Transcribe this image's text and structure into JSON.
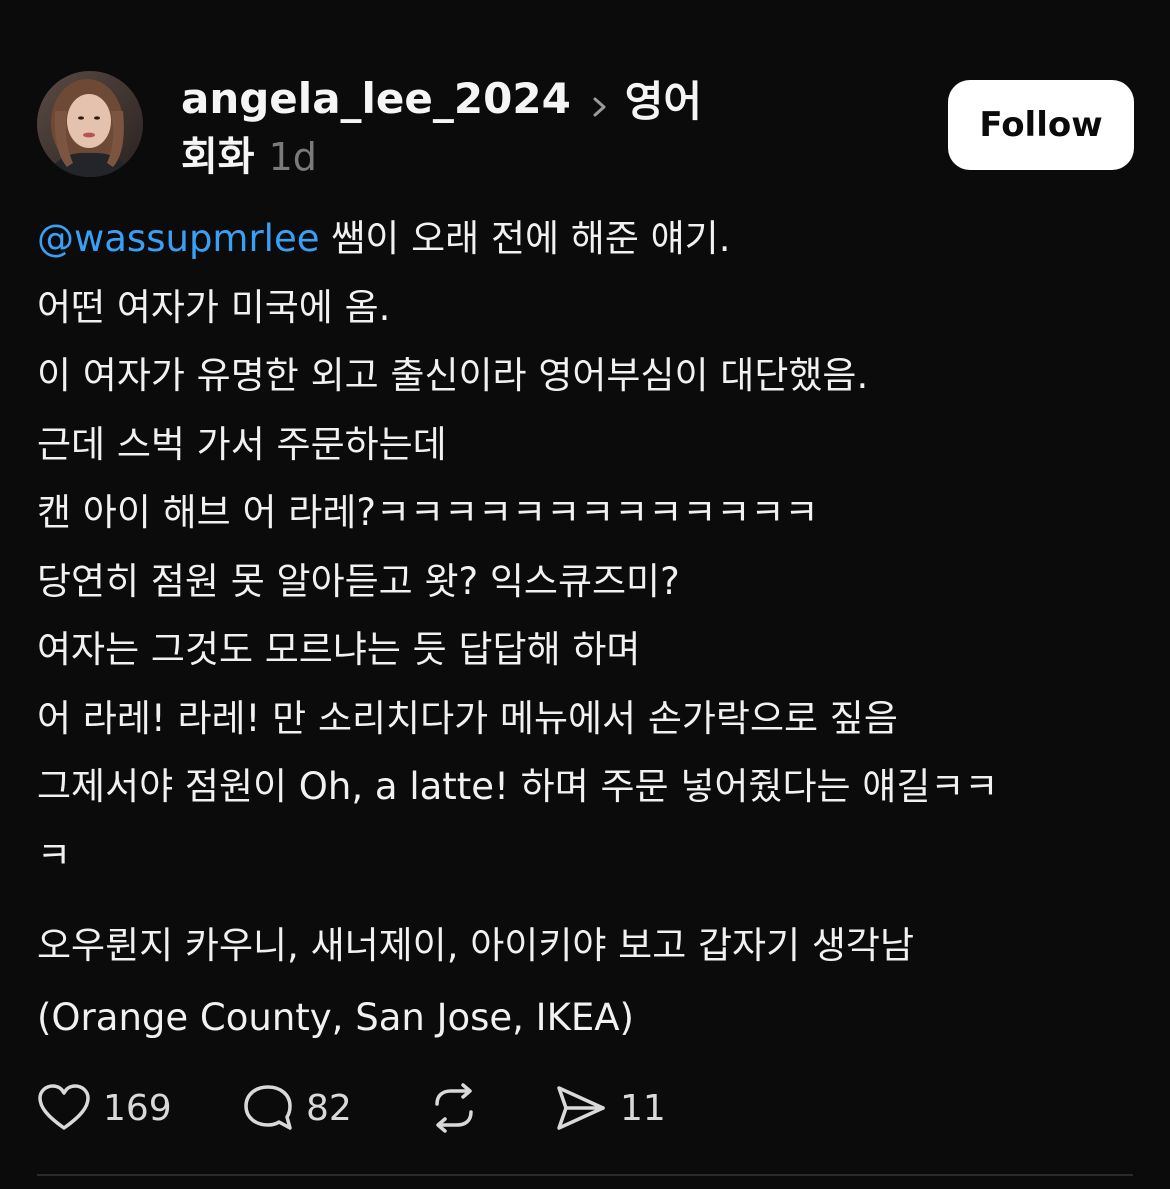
{
  "post": {
    "author": "angela_lee_2024",
    "topic_line1": "영어",
    "topic_line2": "회화",
    "time": "1d",
    "follow_label": "Follow",
    "mention": "@wassupmrlee",
    "line1_rest": " 쌤이 오래 전에 해준 얘기.",
    "lines": [
      "어떤 여자가 미국에 옴.",
      "이 여자가 유명한 외고 출신이라 영어부심이 대단했음.",
      "근데 스벅 가서 주문하는데",
      "캔 아이 해브 어 라레?ㅋㅋㅋㅋㅋㅋㅋㅋㅋㅋㅋㅋㅋ",
      "당연히 점원 못 알아듣고 왓? 익스큐즈미?",
      "여자는 그것도 모르냐는 듯 답답해 하며",
      "어 라레! 라레! 만 소리치다가 메뉴에서 손가락으로 짚음",
      "그제서야 점원이 Oh, a latte! 하며 주문 넣어줬다는 얘길ㅋㅋ",
      "ㅋ"
    ],
    "para2": [
      "오우륀지 카우니, 새너제이, 아이키야 보고 갑자기 생각남",
      "(Orange County, San Jose, IKEA)"
    ]
  },
  "actions": {
    "likes": "169",
    "replies": "82",
    "shares": "11"
  },
  "colors": {
    "background": "#0b0b0b",
    "mention": "#3aa0f5",
    "muted": "#7a7a7a"
  }
}
